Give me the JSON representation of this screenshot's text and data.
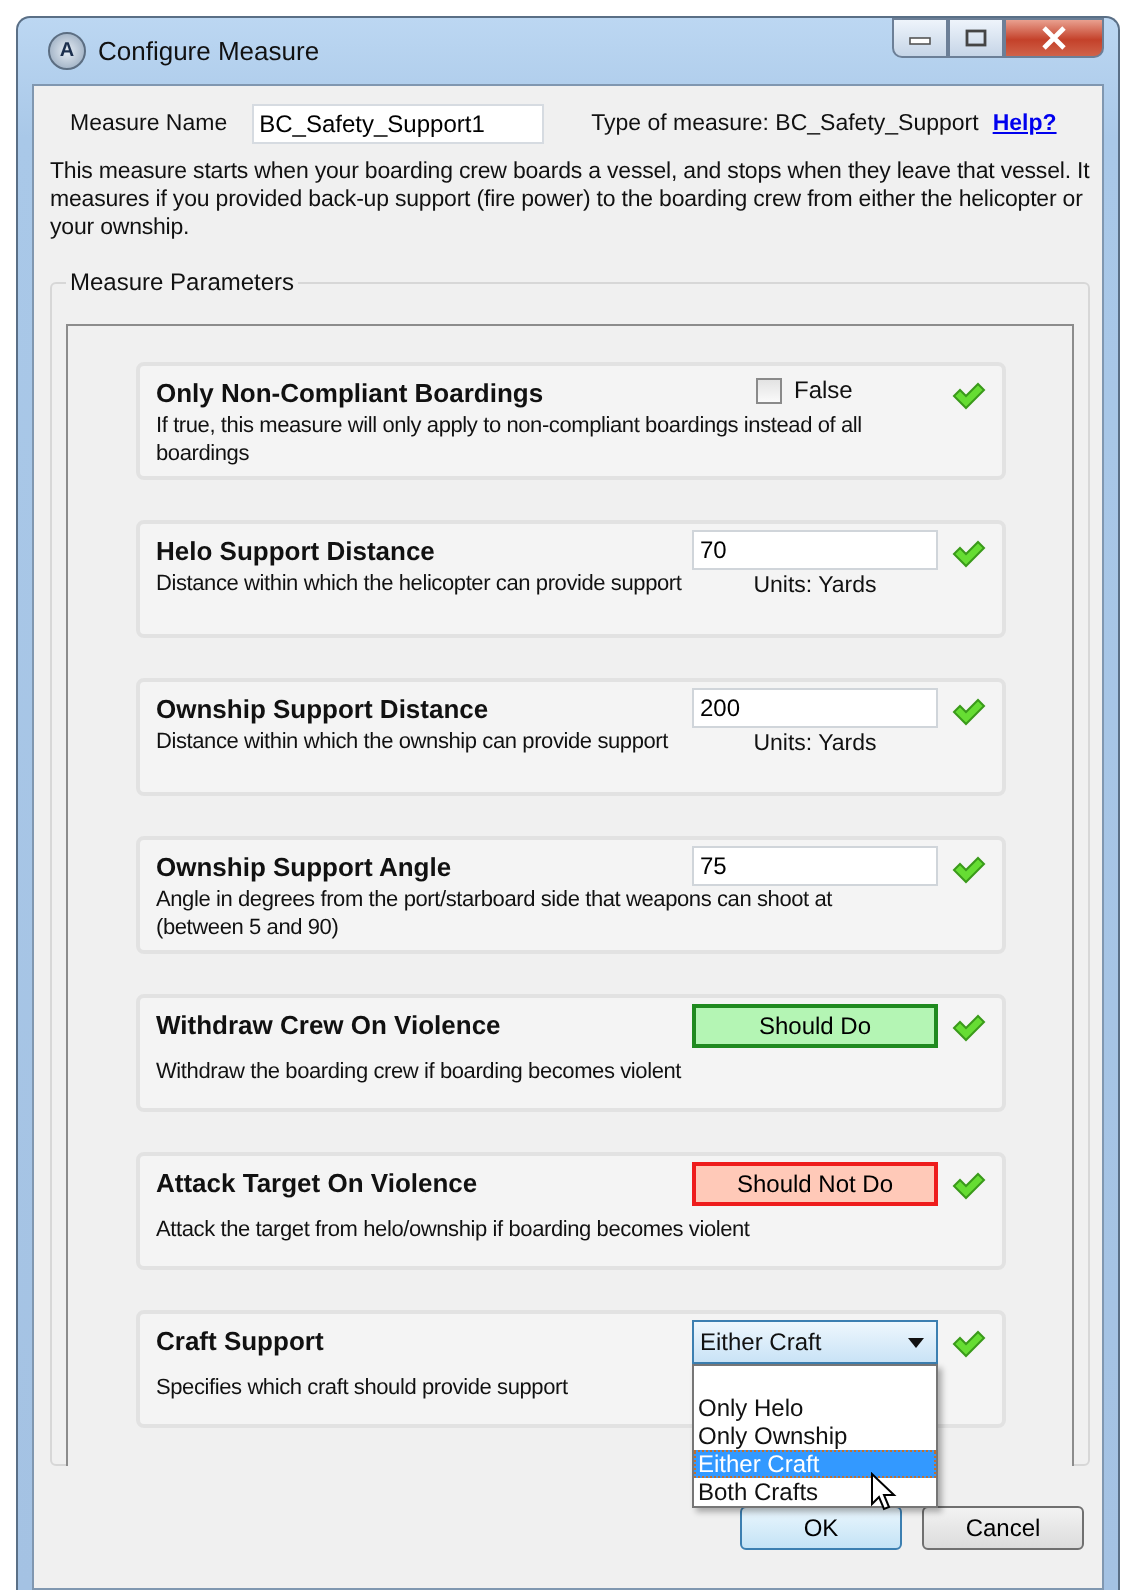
{
  "window": {
    "title": "Configure Measure",
    "app_letter": "A"
  },
  "measure_name": {
    "label": "Measure Name",
    "value": "BC_Safety_Support1"
  },
  "measure_type": "Type of measure: BC_Safety_Support",
  "help_link": "Help?",
  "description": "This measure starts when your boarding crew boards a vessel, and stops when they leave that vessel. It measures if you provided back-up support (fire power) to the boarding crew from either the helicopter or your ownship.",
  "parameters_group": {
    "title": "Measure Parameters",
    "parameters": [
      {
        "kind": "checkbox",
        "title": "Only Non-Compliant Boardings",
        "description": "If true, this measure will only apply to non-compliant boardings instead of all boardings",
        "checked": false,
        "value_label": "False"
      },
      {
        "kind": "number",
        "title": "Helo Support Distance",
        "description": "Distance within which the helicopter can provide support",
        "value": "70",
        "units": "Units: Yards"
      },
      {
        "kind": "number",
        "title": "Ownship Support Distance",
        "description": "Distance within which the ownship can provide support",
        "value": "200",
        "units": "Units: Yards"
      },
      {
        "kind": "number",
        "title": "Ownship Support Angle",
        "description": "Angle in degrees from the port/starboard side that weapons can shoot at (between 5 and 90)",
        "value": "75"
      },
      {
        "kind": "toggle",
        "title": "Withdraw Crew On Violence",
        "description": "Withdraw the boarding crew if boarding becomes violent",
        "on": true,
        "value_label": "Should Do"
      },
      {
        "kind": "toggle",
        "title": "Attack Target On Violence",
        "description": "Attack the target from helo/ownship if boarding becomes violent",
        "on": false,
        "value_label": "Should Not Do"
      },
      {
        "kind": "dropdown",
        "title": "Craft Support",
        "description": "Specifies which craft should provide support",
        "value": "Either Craft",
        "expanded": true,
        "options": [
          {
            "label": "Only Helo",
            "selected": false
          },
          {
            "label": "Only Ownship",
            "selected": false
          },
          {
            "label": "Either Craft",
            "selected": true
          },
          {
            "label": "Both Crafts",
            "selected": false
          }
        ]
      }
    ]
  },
  "buttons": [
    "OK",
    "Cancel"
  ]
}
